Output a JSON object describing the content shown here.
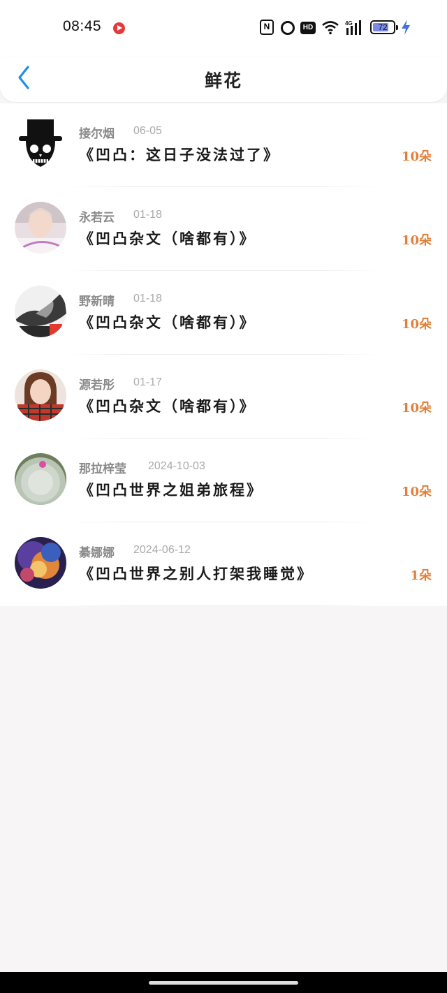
{
  "status_bar": {
    "time": "08:45",
    "battery": "72",
    "icons": [
      "recording-icon",
      "nfc-icon",
      "alarm-icon",
      "hd-icon",
      "wifi-icon",
      "signal-4g-icon",
      "battery-icon",
      "charging-icon"
    ]
  },
  "header": {
    "title": "鲜花",
    "back_icon": "chevron-left-icon",
    "accent": "#1e90e8"
  },
  "colors": {
    "count": "#e0803a",
    "name": "#8a8a8a",
    "date": "#aaaaaa",
    "background": "#f7f5f6"
  },
  "items": [
    {
      "name": "接尔烟",
      "date": "06-05",
      "work": "《凹凸：这日子没法过了》",
      "count": "10朵",
      "avatar": "skull-top-hat"
    },
    {
      "name": "永若云",
      "date": "01-18",
      "work": "《凹凸杂文（啥都有）》",
      "count": "10朵",
      "avatar": "portrait-boy"
    },
    {
      "name": "野新晴",
      "date": "01-18",
      "work": "《凹凸杂文（啥都有）》",
      "count": "10朵",
      "avatar": "monochrome-hands"
    },
    {
      "name": "源若彤",
      "date": "01-17",
      "work": "《凹凸杂文（啥都有）》",
      "count": "10朵",
      "avatar": "portrait-girl"
    },
    {
      "name": "那拉梓莹",
      "date": "2024-10-03",
      "work": "《凹凸世界之姐弟旅程》",
      "count": "10朵",
      "avatar": "cactus"
    },
    {
      "name": "綦娜娜",
      "date": "2024-06-12",
      "work": "《凹凸世界之别人打架我睡觉》",
      "count": "1朵",
      "avatar": "nebula"
    }
  ]
}
